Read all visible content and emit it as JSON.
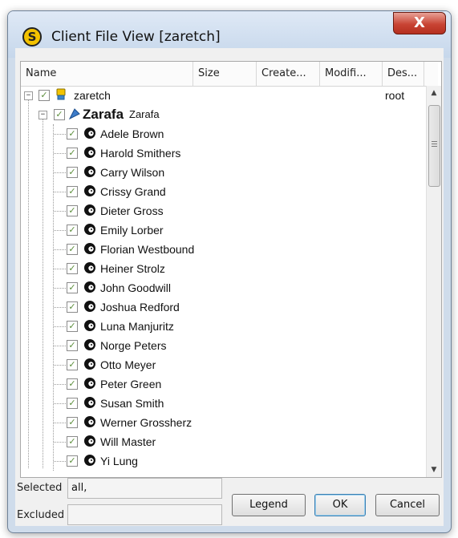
{
  "window": {
    "title": "Client File View [zaretch]",
    "close_label": "X"
  },
  "columns": [
    "Name",
    "Size",
    "Create...",
    "Modifi...",
    "Des..."
  ],
  "root": {
    "name": "zaretch",
    "description": "root"
  },
  "group": {
    "logo_text": "Zarafa",
    "name": "Zarafa"
  },
  "users": [
    "Adele Brown",
    "Harold Smithers",
    "Carry Wilson",
    "Crissy Grand",
    "Dieter Gross",
    "Emily Lorber",
    "Florian Westbound",
    "Heiner Strolz",
    "John Goodwill",
    "Joshua Redford",
    "Luna Manjuritz",
    "Norge Peters",
    "Otto Meyer",
    "Peter Green",
    "Susan Smith",
    "Werner Grossherz",
    "Will Master",
    "Yi Lung"
  ],
  "footer": {
    "selected_label": "Selected",
    "selected_value": "all,",
    "excluded_label": "Excluded",
    "excluded_value": ""
  },
  "buttons": {
    "legend": "Legend",
    "ok": "OK",
    "cancel": "Cancel"
  },
  "colors": {
    "check": "#5a8d3a",
    "close_button": "#c94434",
    "app_icon": "#f3c200"
  }
}
